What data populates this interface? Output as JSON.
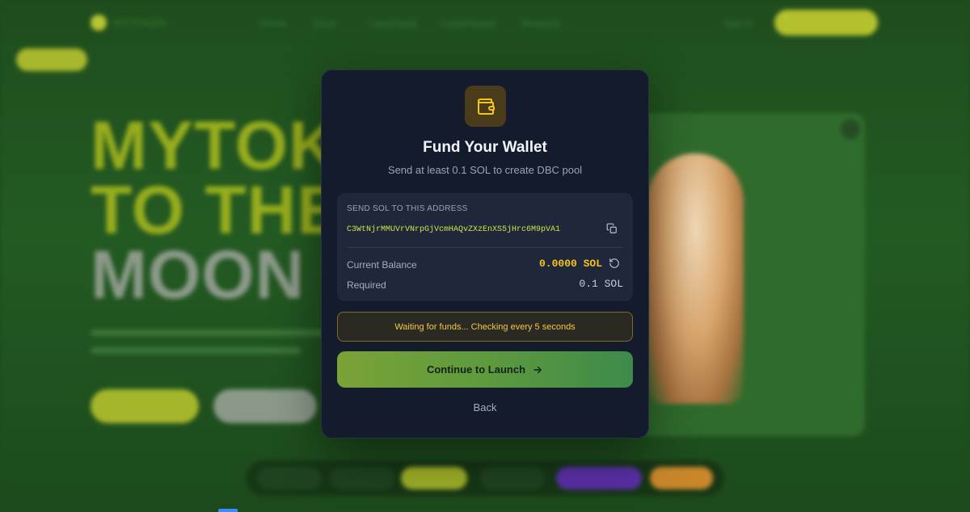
{
  "background": {
    "logo_text": "MYTOKEN",
    "nav_links": [
      "Home",
      "Docs",
      "Launchpad",
      "Leaderboard",
      "Rewards"
    ],
    "signin_label": "Sign in",
    "hero_lines": [
      "MYTOKEN",
      "TO THE",
      "MOON"
    ]
  },
  "modal": {
    "icon": "wallet-icon",
    "title": "Fund Your Wallet",
    "subtitle": "Send at least 0.1 SOL to create DBC pool",
    "address_label": "SEND SOL TO THIS ADDRESS",
    "address": "C3WtNjrMMUVrVNrpGjVcmHAQvZXzEnXS5jHrc6M9pVA1",
    "copy_icon": "copy-icon",
    "balance_label": "Current Balance",
    "balance_value": "0.0000 SOL",
    "refresh_icon": "refresh-icon",
    "required_label": "Required",
    "required_value": "0.1 SOL",
    "status_text": "Waiting for funds... Checking every 5 seconds",
    "continue_label": "Continue to Launch",
    "continue_icon": "arrow-right-icon",
    "back_label": "Back"
  },
  "colors": {
    "accent_yellow": "#f5c518",
    "address_green": "#d2e14a",
    "modal_bg": "#141b2d",
    "button_gradient_start": "#7aa336",
    "button_gradient_end": "#3d8a4a"
  }
}
